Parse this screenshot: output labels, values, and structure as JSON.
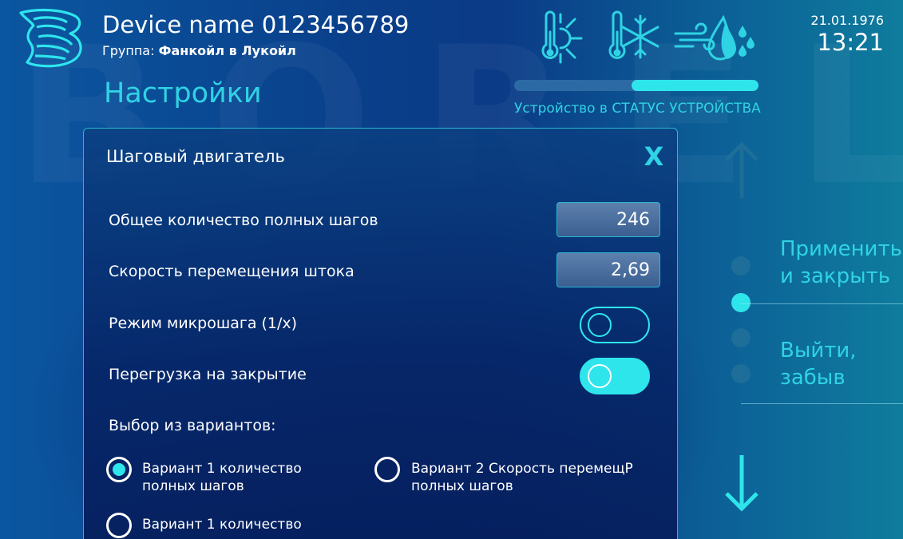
{
  "header": {
    "device_name": "Device name 0123456789",
    "group_label": "Группа:",
    "group_value": "Фанкойл в Лукойл",
    "date": "21.01.1976",
    "time": "13:21",
    "watermark": "BORELY",
    "mode_icons": [
      "heating-thermometer-sun-icon",
      "cooling-thermometer-snowflake-icon",
      "ventilation-humidity-icon"
    ]
  },
  "page": {
    "title": "Настройки",
    "status_text": "Устройство в СТАТУС УСТРОЙСТВА",
    "status_progress": 0.5
  },
  "panel": {
    "title": "Шаговый двигатель",
    "close_label": "X",
    "rows": {
      "total_steps": {
        "label": "Общее количество полных шагов",
        "value": "246"
      },
      "rod_speed": {
        "label": "Скорость перемещения штока",
        "value": "2,69"
      },
      "microstep": {
        "label": "Режим микрошага (1/x)",
        "state": false
      },
      "overload": {
        "label": "Перегрузка на закрытие",
        "state": true
      }
    },
    "options_label": "Выбор из вариантов:",
    "options": [
      {
        "line1": "Вариант 1 количество",
        "line2": "полных шагов",
        "checked": true
      },
      {
        "line1": "Вариант 2 Скорость перемещР",
        "line2": "полных шагов",
        "checked": false
      },
      {
        "line1": "Вариант 1 количество",
        "line2": "",
        "checked": false
      }
    ]
  },
  "side": {
    "apply_line1": "Применить",
    "apply_line2": "и закрыть",
    "exit_line1": "Выйти,",
    "exit_line2": "забыв",
    "nav_dots": 4,
    "active_dot": 1
  },
  "colors": {
    "accent": "#2ee5ec",
    "accent_text": "#2fd3e3",
    "background": "#0a3f8a"
  }
}
